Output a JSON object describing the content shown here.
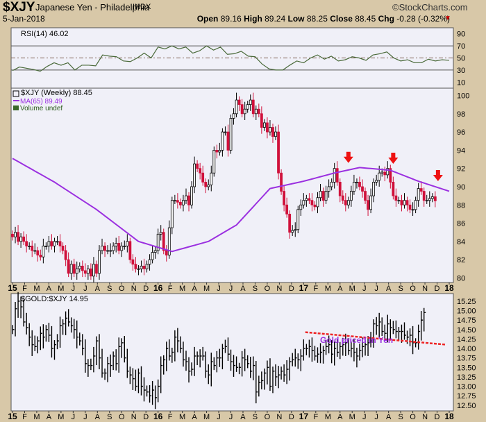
{
  "header": {
    "symbol": "$XJY",
    "name": "Japanese Yen - Philadelphia",
    "exchange": "INDX",
    "copyright": "©StockCharts.com",
    "date": "5-Jan-2018",
    "open_label": "Open",
    "open": "89.16",
    "high_label": "High",
    "high": "89.24",
    "low_label": "Low",
    "low": "88.25",
    "close_label": "Close",
    "close": "88.45",
    "chg_label": "Chg",
    "chg": "-0.28 (-0.32%)"
  },
  "chart_data": [
    {
      "type": "line",
      "title": "RSI(14) 46.02",
      "yticks": [
        90,
        70,
        50,
        30,
        10
      ],
      "ylim": [
        0,
        100
      ],
      "levels": [
        70,
        50,
        30
      ],
      "values": [
        29,
        35,
        33,
        31,
        28,
        36,
        42,
        38,
        42,
        30,
        38,
        38,
        37,
        55,
        53,
        52,
        45,
        44,
        50,
        58,
        50,
        68,
        65,
        70,
        65,
        68,
        58,
        62,
        70,
        63,
        68,
        56,
        57,
        61,
        53,
        52,
        40,
        32,
        30,
        30,
        38,
        45,
        42,
        50,
        55,
        48,
        53,
        45,
        47,
        52,
        50,
        46,
        55,
        57,
        60,
        50,
        45,
        47,
        42,
        42,
        48,
        45,
        47,
        46.02
      ]
    },
    {
      "type": "candlestick",
      "title": "$XJY (Weekly) 88.45",
      "legend": [
        "MA(65) 89.49",
        "Volume undef"
      ],
      "ylim": [
        79.5,
        100.8
      ],
      "yticks": [
        100,
        98,
        96,
        94,
        92,
        90,
        88,
        86,
        84,
        82,
        80
      ],
      "closes": [
        84.5,
        85,
        84,
        84.5,
        84,
        83.5,
        83.5,
        83,
        83,
        82.5,
        82.3,
        83.5,
        83.5,
        84,
        83.5,
        84,
        84,
        83.5,
        83,
        82,
        80.5,
        81.5,
        80.5,
        81,
        81.3,
        80.8,
        80.5,
        81,
        80.2,
        81.5,
        80.5,
        83,
        83.5,
        83,
        83,
        83,
        83.5,
        83.8,
        83,
        83.5,
        83.5,
        84,
        82,
        81.5,
        81,
        81,
        81.3,
        81,
        81.5,
        82,
        82.8,
        83,
        84.8,
        85,
        83,
        82.5,
        85.5,
        88.5,
        88.5,
        88.3,
        88,
        88.5,
        89,
        88,
        90,
        92.5,
        92,
        91.5,
        90.5,
        90,
        90.2,
        91.5,
        94,
        93.8,
        94,
        96,
        96,
        94,
        97.5,
        98,
        99.5,
        99,
        98,
        98.5,
        99,
        99.5,
        98,
        98.5,
        98,
        96.5,
        97,
        96,
        96.5,
        95.5,
        96,
        91.5,
        89.5,
        88,
        87,
        85,
        85.2,
        85.3,
        87.5,
        88,
        88.5,
        88.7,
        88.5,
        88,
        87.8,
        88.8,
        89.5,
        88.5,
        89.5,
        90,
        90.5,
        92,
        90.5,
        89,
        88.5,
        88,
        88.5,
        89.5,
        90.5,
        90.5,
        90,
        89.5,
        88.5,
        87.5,
        89,
        90.5,
        90.7,
        91.5,
        91.6,
        91.3,
        92,
        90.5,
        89,
        88.5,
        88.5,
        88,
        88.5,
        88,
        87.5,
        87.5,
        88.5,
        89.8,
        89.5,
        88.5,
        88.5,
        88.7,
        88.9,
        88.45
      ],
      "ma65": [
        [
          0,
          93.1
        ],
        [
          15,
          90.5
        ],
        [
          30,
          87.5
        ],
        [
          45,
          84
        ],
        [
          57,
          82.9
        ],
        [
          70,
          84
        ],
        [
          80,
          85.8
        ],
        [
          92,
          89.8
        ],
        [
          104,
          90.6
        ],
        [
          115,
          91.5
        ],
        [
          124,
          92.1
        ],
        [
          135,
          91.8
        ],
        [
          145,
          90.6
        ],
        [
          156,
          89.5
        ]
      ],
      "arrows": [
        {
          "week": 120,
          "price": 92.3
        },
        {
          "week": 136,
          "price": 92.2
        },
        {
          "week": 152,
          "price": 90.3
        }
      ]
    },
    {
      "type": "ohlc",
      "title": "$GOLD:$XJY 14.95",
      "ylim": [
        12.35,
        15.45
      ],
      "yticks": [
        15.25,
        15.0,
        14.75,
        14.5,
        14.25,
        14.0,
        13.75,
        13.5,
        13.25,
        13.0,
        12.75,
        12.5
      ],
      "closes": [
        14.5,
        15.05,
        15.25,
        15.1,
        14.7,
        14.55,
        14.3,
        14.1,
        14.05,
        14.2,
        14.4,
        14.3,
        14.5,
        14.35,
        14.0,
        14.1,
        14.2,
        14.6,
        14.65,
        14.8,
        14.7,
        14.6,
        14.5,
        14.3,
        14.2,
        14.0,
        13.6,
        13.55,
        13.55,
        13.8,
        14.2,
        13.75,
        13.35,
        13.35,
        13.6,
        13.55,
        13.8,
        13.6,
        14.05,
        14.15,
        13.75,
        13.4,
        13.3,
        13.2,
        13.0,
        13.35,
        13.0,
        12.9,
        12.85,
        12.75,
        12.9,
        12.7,
        13.0,
        13.55,
        13.7,
        14.0,
        13.8,
        13.9,
        14.3,
        14.2,
        14.0,
        13.7,
        13.65,
        13.4,
        13.45,
        13.8,
        13.8,
        13.8,
        13.8,
        13.4,
        13.3,
        13.65,
        13.55,
        13.75,
        13.75,
        14.0,
        14.05,
        13.85,
        13.65,
        13.55,
        13.5,
        13.5,
        13.75,
        13.7,
        13.6,
        13.4,
        13.55,
        12.85,
        13.1,
        13.15,
        13.35,
        13.5,
        13.0,
        13.4,
        13.25,
        13.3,
        13.4,
        13.3,
        13.45,
        13.65,
        13.7,
        13.75,
        13.7,
        13.8,
        14.0,
        14.0,
        14.05,
        13.95,
        13.8,
        13.85,
        13.9,
        13.95,
        14.05,
        14.1,
        13.85,
        14.0,
        13.9,
        14.05,
        14.1,
        14.15,
        13.95,
        14.0,
        13.9,
        13.8,
        13.95,
        14.05,
        14.1,
        14.15,
        14.2,
        14.65,
        14.6,
        14.7,
        14.45,
        14.4,
        14.65,
        14.55,
        14.5,
        14.45,
        14.45,
        14.45,
        14.35,
        14.3,
        14.35,
        14.15,
        14.15,
        14.45,
        14.75,
        14.95
      ],
      "annotation": "Gold priced in Yen",
      "trendline": [
        [
          104.6,
          14.43
        ],
        [
          155,
          14.1
        ]
      ]
    }
  ],
  "xaxis": {
    "labels": [
      "15",
      "F",
      "M",
      "A",
      "M",
      "J",
      "J",
      "A",
      "S",
      "O",
      "N",
      "D",
      "16",
      "F",
      "M",
      "A",
      "M",
      "J",
      "J",
      "A",
      "S",
      "O",
      "N",
      "D",
      "17",
      "F",
      "M",
      "A",
      "M",
      "J",
      "J",
      "A",
      "S",
      "O",
      "N",
      "D",
      "18"
    ]
  },
  "colors": {
    "up": "#ffffff",
    "down": "#d0103a",
    "ma": "#9b30e0",
    "rsi": "#4a6a3a",
    "arrow": "#ee1111",
    "trend": "#ee2222",
    "panel": "#f0f0f8",
    "annotation": "#9b30e0"
  }
}
